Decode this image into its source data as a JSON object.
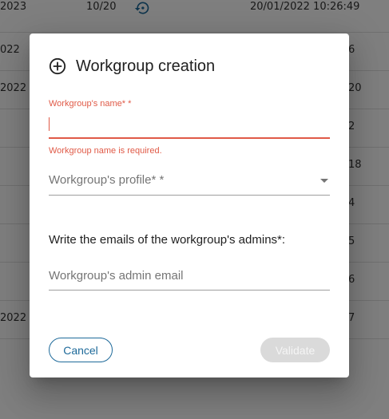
{
  "background_table": {
    "rows": [
      {
        "date": "2023",
        "count": "10/20",
        "timestamp": "20/01/2022 10:26:49",
        "right": ""
      },
      {
        "date": "022",
        "count": "",
        "timestamp": "",
        "right": "6"
      },
      {
        "date": "2022",
        "count": "",
        "timestamp": "",
        "right": "20"
      },
      {
        "date": "",
        "count": "",
        "timestamp": "",
        "right": "2"
      },
      {
        "date": "",
        "count": "",
        "timestamp": "",
        "right": "18"
      },
      {
        "date": "",
        "count": "",
        "timestamp": "",
        "right": "4"
      },
      {
        "date": "",
        "count": "",
        "timestamp": "",
        "right": "5"
      },
      {
        "date": "",
        "count": "",
        "timestamp": "",
        "right": "6"
      },
      {
        "date": "2022",
        "count": "",
        "timestamp": "",
        "right": "7"
      }
    ],
    "row_icon": "history-icon"
  },
  "dialog": {
    "title": "Workgroup creation",
    "title_icon": "add-circle-icon",
    "name_field": {
      "label": "Workgroup's name* *",
      "value": "",
      "error": "Workgroup name is required."
    },
    "profile_field": {
      "placeholder": "Workgroup's profile* *",
      "icon": "dropdown-arrow-icon"
    },
    "admins_section_label": "Write the emails of the workgroup's admins*:",
    "admin_email_field": {
      "placeholder": "Workgroup's admin email"
    },
    "cancel_label": "Cancel",
    "validate_label": "Validate"
  },
  "colors": {
    "error": "#e05a47",
    "primary": "#1e6a9a",
    "disabled_bg": "#dadada"
  }
}
